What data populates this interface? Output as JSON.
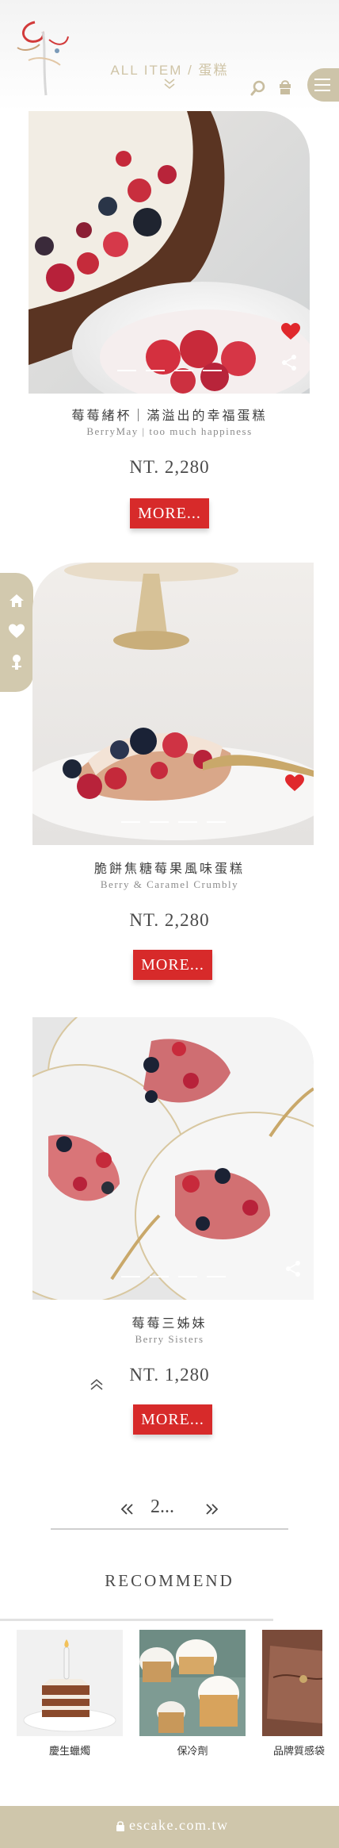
{
  "header": {
    "title": "ALL ITEM / 蛋糕",
    "icons": [
      "logo-mark",
      "chevron-down-double-icon",
      "search-icon",
      "bag-icon",
      "menu-icon"
    ]
  },
  "side_tab": {
    "icons": [
      "home-icon",
      "heart-icon",
      "user-icon"
    ]
  },
  "products": [
    {
      "name": "莓莓緒杯｜滿溢出的幸福蛋糕",
      "subtitle": "BerryMay | too much happiness",
      "price": "NT. 2,280",
      "more_label": "MORE...",
      "favorited": true,
      "slides": 4
    },
    {
      "name": "脆餅焦糖莓果風味蛋糕",
      "subtitle": "Berry & Caramel Crumbly",
      "price": "NT. 2,280",
      "more_label": "MORE...",
      "favorited": true,
      "slides": 4
    },
    {
      "name": "莓莓三姊妹",
      "subtitle": "Berry Sisters",
      "price": "NT. 1,280",
      "more_label": "MORE...",
      "favorited": false,
      "slides": 4
    }
  ],
  "pager": {
    "current": "2...",
    "prev_icon": "double-chevron-left-icon",
    "next_icon": "double-chevron-right-icon"
  },
  "recommend": {
    "title": "RECOMMEND",
    "items": [
      {
        "label": "慶生蠟燭"
      },
      {
        "label": "保冷劑"
      },
      {
        "label": "品牌質感袋"
      }
    ]
  },
  "footer": {
    "url": "escake.com.tw"
  },
  "colors": {
    "accent_gold": "#cdc4a9",
    "button_red": "#d72a2a",
    "heart_red": "#e0282c"
  }
}
